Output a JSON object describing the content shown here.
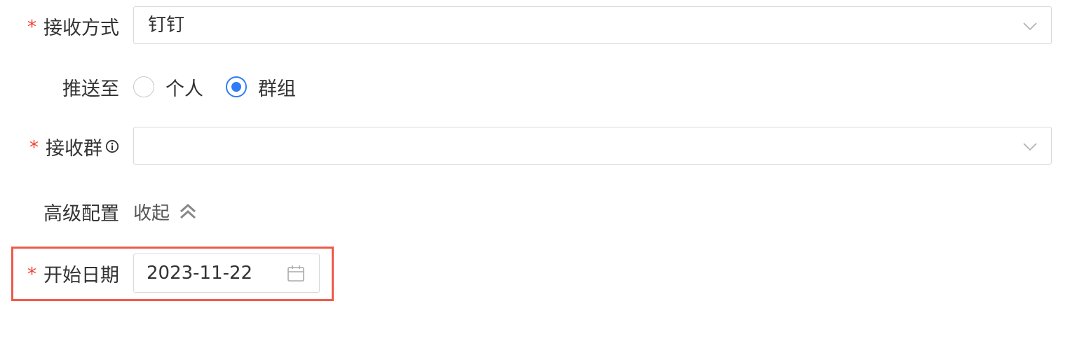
{
  "form": {
    "receive_method": {
      "required_mark": "*",
      "label": "接收方式",
      "value": "钉钉"
    },
    "push_to": {
      "label": "推送至",
      "options": [
        {
          "label": "个人",
          "checked": false
        },
        {
          "label": "群组",
          "checked": true
        }
      ]
    },
    "receive_group": {
      "required_mark": "*",
      "label": "接收群",
      "value": ""
    },
    "advanced": {
      "label": "高级配置",
      "toggle_label": "收起"
    },
    "start_date": {
      "required_mark": "*",
      "label": "开始日期",
      "value": "2023-11-22"
    }
  },
  "colors": {
    "accent": "#2f7cf6",
    "required": "#f04134",
    "highlight": "#ef5a4b",
    "border": "#d9d9d9"
  },
  "icons": {
    "select_arrow": "chevron-down-icon",
    "info": "info-icon",
    "collapse": "double-chevron-up-icon",
    "date": "calendar-icon"
  }
}
